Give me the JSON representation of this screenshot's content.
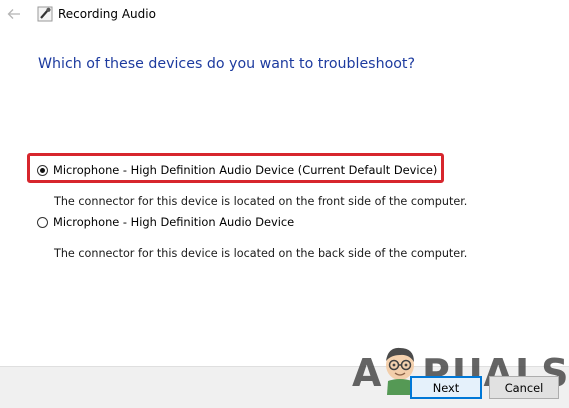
{
  "window": {
    "title": "Recording Audio"
  },
  "heading": "Which of these devices do you want to troubleshoot?",
  "options": [
    {
      "label": "Microphone - High Definition Audio Device (Current Default Device)",
      "description": "The connector for this device is located on the front side of the computer.",
      "selected": true
    },
    {
      "label": "Microphone - High Definition Audio Device",
      "description": "The connector for this device is located on the back side of the computer.",
      "selected": false
    }
  ],
  "buttons": {
    "next": "Next",
    "cancel": "Cancel"
  },
  "watermark": {
    "left": "A",
    "right": "PUALS"
  },
  "colors": {
    "heading": "#1d3b9f",
    "highlight": "#d7262d",
    "focus": "#0078d7",
    "footer": "#f0f0f0"
  },
  "icons": {
    "back": "arrow-left-icon",
    "app": "microphone-icon"
  }
}
